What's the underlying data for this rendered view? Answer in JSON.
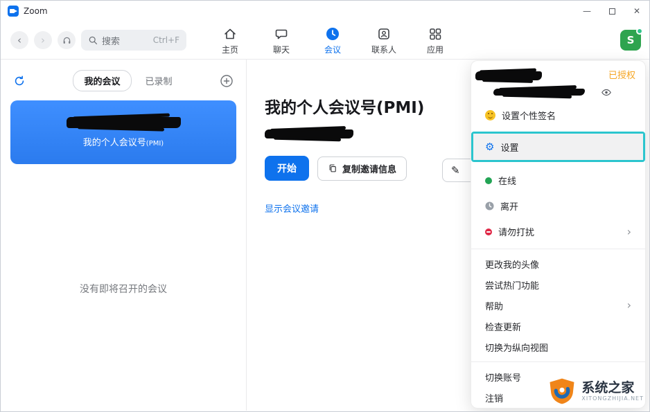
{
  "window": {
    "title": "Zoom"
  },
  "topbar": {
    "search_label": "搜索",
    "search_shortcut": "Ctrl+F",
    "nav": [
      {
        "label": "主页"
      },
      {
        "label": "聊天"
      },
      {
        "label": "会议"
      },
      {
        "label": "联系人"
      },
      {
        "label": "应用"
      }
    ],
    "avatar_letter": "S"
  },
  "sidebar": {
    "tab_my_meetings": "我的会议",
    "tab_recorded": "已录制",
    "card_subtitle": "我的个人会议号",
    "card_subtitle_suffix": "(PMI)",
    "empty_text": "没有即将召开的会议"
  },
  "main": {
    "title": "我的个人会议号(PMI)",
    "start_button": "开始",
    "copy_button": "复制邀请信息",
    "show_invite_link": "显示会议邀请"
  },
  "menu": {
    "authorized_badge": "已授权",
    "signature": "设置个性签名",
    "settings": "设置",
    "status_online": "在线",
    "status_away": "离开",
    "status_dnd": "请勿打扰",
    "change_avatar": "更改我的头像",
    "try_features": "尝试热门功能",
    "help": "帮助",
    "check_updates": "检查更新",
    "portrait_view": "切换为纵向视图",
    "switch_account": "切换账号",
    "sign_out": "注销"
  },
  "watermark": {
    "title": "系统之家",
    "subtitle": "XITONGZHIJIA.NET"
  },
  "colors": {
    "accent": "#0E72ED",
    "highlight_border": "#2BC5CE",
    "authorized": "#F5A623",
    "online": "#23A455",
    "dnd": "#E02847",
    "card_blue": "#2B7BEE"
  }
}
